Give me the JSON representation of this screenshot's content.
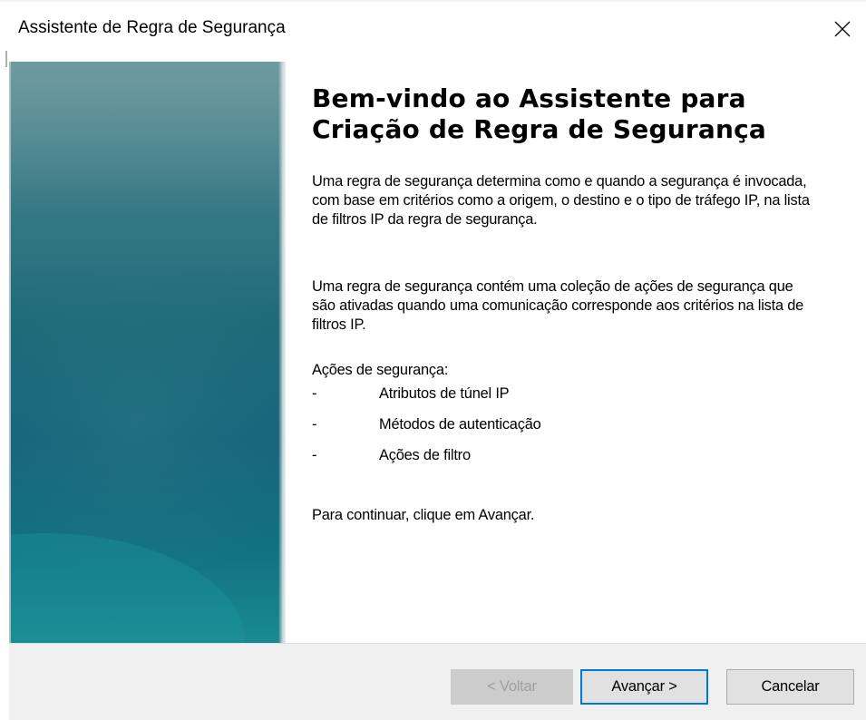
{
  "window": {
    "title": "Assistente de Regra de Segurança",
    "close_icon": "close-icon"
  },
  "colors": {
    "banner_top": "#5d8e94",
    "banner_bottom": "#1a8a90",
    "focus_border": "#0078d7",
    "button_bg": "#e1e1e1",
    "footer_bg": "#f0f0f0"
  },
  "content": {
    "heading_line1": "Bem-vindo ao Assistente para",
    "heading_line2": "Criação de Regra de Segurança",
    "paragraph1": "Uma regra de segurança determina como e quando a segurança é invocada, com base em critérios como a origem, o destino e o tipo de tráfego IP, na lista de filtros IP da regra de segurança.",
    "paragraph2": "Uma regra de segurança contém uma coleção de ações de segurança que são ativadas quando uma comunicação corresponde aos critérios na lista de filtros IP.",
    "actions_title": "Ações de segurança:",
    "actions": [
      {
        "bullet": "-",
        "label": "Atributos de túnel IP"
      },
      {
        "bullet": "-",
        "label": "Métodos de autenticação"
      },
      {
        "bullet": "-",
        "label": "Ações de filtro"
      }
    ],
    "continue_text": "Para continuar, clique em Avançar."
  },
  "buttons": {
    "back": "< Voltar",
    "next": "Avançar >",
    "cancel": "Cancelar"
  }
}
